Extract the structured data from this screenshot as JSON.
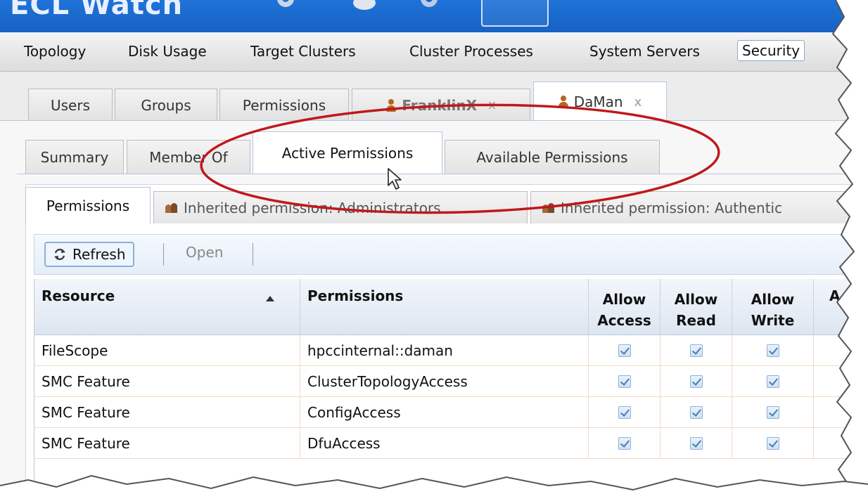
{
  "app": {
    "title": "ECL Watch"
  },
  "menu": {
    "items": [
      "Topology",
      "Disk Usage",
      "Target Clusters",
      "Cluster Processes",
      "System Servers",
      "Security"
    ],
    "active": "Security"
  },
  "outer_tabs": [
    {
      "label": "Users"
    },
    {
      "label": "Groups"
    },
    {
      "label": "Permissions"
    },
    {
      "label": "FranklinX",
      "closable": true,
      "icon": "user-icon"
    },
    {
      "label": "DaMan",
      "closable": true,
      "icon": "user-icon",
      "selected": true
    }
  ],
  "close_glyph": "x",
  "inner_tabs": [
    {
      "label": "Summary"
    },
    {
      "label": "Member Of"
    },
    {
      "label": "Active Permissions",
      "selected": true
    },
    {
      "label": "Available Permissions"
    }
  ],
  "perm_tabs": [
    {
      "label": "Permissions",
      "selected": true
    },
    {
      "label": "Inherited permission: Administrators",
      "icon": "group-icon"
    },
    {
      "label": "Inherited permission: Authentic",
      "icon": "group-icon"
    }
  ],
  "toolbar": {
    "refresh_label": "Refresh",
    "open_label": "Open"
  },
  "grid": {
    "columns": [
      "Resource",
      "Permissions",
      "Allow Access",
      "Allow Read",
      "Allow Write",
      "A"
    ],
    "column_lines": {
      "allow_access": [
        "Allow",
        "Access"
      ],
      "allow_read": [
        "Allow",
        "Read"
      ],
      "allow_write": [
        "Allow",
        "Write"
      ]
    },
    "rows": [
      {
        "resource": "FileScope",
        "permission": "hpccinternal::daman",
        "allow_access": true,
        "allow_read": true,
        "allow_write": true
      },
      {
        "resource": "SMC Feature",
        "permission": "ClusterTopologyAccess",
        "allow_access": true,
        "allow_read": true,
        "allow_write": true
      },
      {
        "resource": "SMC Feature",
        "permission": "ConfigAccess",
        "allow_access": true,
        "allow_read": true,
        "allow_write": true
      },
      {
        "resource": "SMC Feature",
        "permission": "DfuAccess",
        "allow_access": true,
        "allow_read": true,
        "allow_write": true
      }
    ]
  },
  "colors": {
    "header_blue": "#1f73d8",
    "annotation_red": "#c0181c"
  }
}
